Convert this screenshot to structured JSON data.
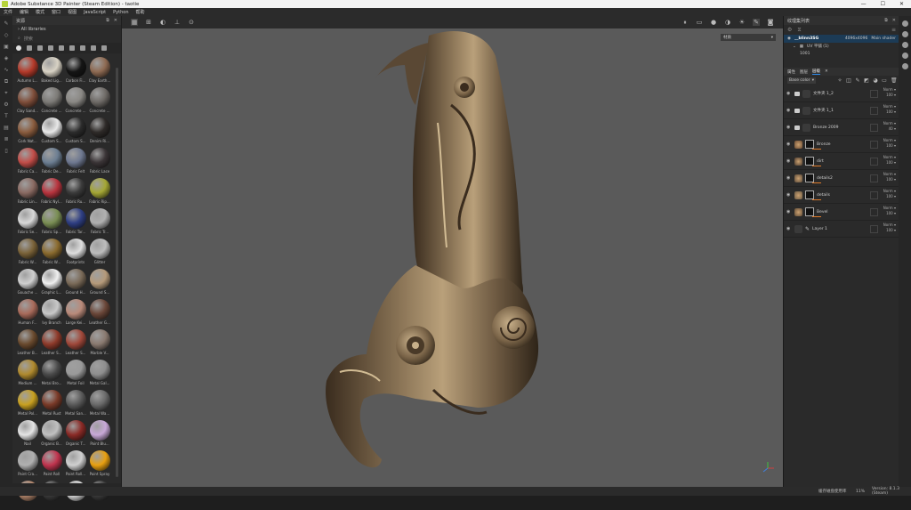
{
  "window": {
    "title": "Adobe Substance 3D Painter (Steam Edition) - taotie",
    "buttons": [
      "—",
      "☐",
      "✕"
    ]
  },
  "menu": [
    "文件",
    "编辑",
    "模式",
    "窗口",
    "视图",
    "JavaScript",
    "Python",
    "帮助"
  ],
  "shelf": {
    "title": "资源",
    "path": "All libraries",
    "search_placeholder": "搜索",
    "materials": [
      {
        "label": "Autumn L...",
        "color": "#b53a2a"
      },
      {
        "label": "Baked Lig...",
        "color": "#d8d2c4"
      },
      {
        "label": "Carbon Fi...",
        "color": "#151515"
      },
      {
        "label": "Clay Earth...",
        "color": "#8e6a52"
      },
      {
        "label": "Clay Sand...",
        "color": "#7f4e3a"
      },
      {
        "label": "Concrete ...",
        "color": "#7c7a76"
      },
      {
        "label": "Concrete ...",
        "color": "#8a8884"
      },
      {
        "label": "Concrete ...",
        "color": "#6e6a66"
      },
      {
        "label": "Cork Nat...",
        "color": "#8a5c3e"
      },
      {
        "label": "Custom S...",
        "color": "#e8e8e8"
      },
      {
        "label": "Custom S...",
        "color": "#2b2b2b"
      },
      {
        "label": "Denim Ri...",
        "color": "#2e2a28"
      },
      {
        "label": "Fabric Ca...",
        "color": "#c24d48"
      },
      {
        "label": "Fabric De...",
        "color": "#6c7e92"
      },
      {
        "label": "Fabric Felt",
        "color": "#6e7890"
      },
      {
        "label": "Fabric Lace",
        "color": "#3a3436"
      },
      {
        "label": "Fabric Lin...",
        "color": "#8a6a62"
      },
      {
        "label": "Fabric Nyl...",
        "color": "#b8343e"
      },
      {
        "label": "Fabric Ru...",
        "color": "#3a3a3a"
      },
      {
        "label": "Fabric Rip...",
        "color": "#a4a634"
      },
      {
        "label": "Fabric Se...",
        "color": "#d8d8d8"
      },
      {
        "label": "Fabric Sp...",
        "color": "#7a8e54"
      },
      {
        "label": "Fabric Tar...",
        "color": "#2e3e82"
      },
      {
        "label": "Fabric Tr...",
        "color": "#b0b0b0"
      },
      {
        "label": "Fabric W...",
        "color": "#7a6238"
      },
      {
        "label": "Fabric W...",
        "color": "#8a6a2e"
      },
      {
        "label": "Footprints",
        "color": "#dedede"
      },
      {
        "label": "Glitter",
        "color": "#bdbdbd"
      },
      {
        "label": "Gouache ...",
        "color": "#d0d0d0"
      },
      {
        "label": "Graphic L...",
        "color": "#f0f0f0"
      },
      {
        "label": "Ground H...",
        "color": "#7a6a58"
      },
      {
        "label": "Ground S...",
        "color": "#b59a7a"
      },
      {
        "label": "Human F...",
        "color": "#a86a5a"
      },
      {
        "label": "Ivy Branch",
        "color": "#c8c8c8"
      },
      {
        "label": "Large Kei...",
        "color": "#b98a7a"
      },
      {
        "label": "Leather G...",
        "color": "#6a4638"
      },
      {
        "label": "Leather B...",
        "color": "#6a4a2e"
      },
      {
        "label": "Leather S...",
        "color": "#8e3a2a"
      },
      {
        "label": "Leather S...",
        "color": "#a0483a"
      },
      {
        "label": "Marble V...",
        "color": "#8a7a70"
      },
      {
        "label": "Medium ...",
        "color": "#b08a2e"
      },
      {
        "label": "Metal Bro...",
        "color": "#4a4a4a"
      },
      {
        "label": "Metal Foil",
        "color": "#9a9a9a"
      },
      {
        "label": "Metal Gal...",
        "color": "#8e8e8e"
      },
      {
        "label": "Metal Pol...",
        "color": "#c8a020"
      },
      {
        "label": "Metal Rust",
        "color": "#7a3a28"
      },
      {
        "label": "Metal San...",
        "color": "#5a5a5a"
      },
      {
        "label": "Metal Wa...",
        "color": "#6a6a6a"
      },
      {
        "label": "Nail",
        "color": "#e4e4e4"
      },
      {
        "label": "Organic B...",
        "color": "#c0c0c0"
      },
      {
        "label": "Organic T...",
        "color": "#8a2a26"
      },
      {
        "label": "Paint Blu...",
        "color": "#c8a8d8"
      },
      {
        "label": "Paint Cra...",
        "color": "#b0b0b0"
      },
      {
        "label": "Paint Roll",
        "color": "#c0344e"
      },
      {
        "label": "Paint Roll...",
        "color": "#d0d0d0"
      },
      {
        "label": "Paint Spray",
        "color": "#e8a010"
      },
      {
        "label": "",
        "color": "#b0846a"
      },
      {
        "label": "",
        "color": "#3a3a3a"
      },
      {
        "label": "",
        "color": "#d8d8d8"
      },
      {
        "label": "",
        "color": "#3a3a3a"
      }
    ]
  },
  "viewport": {
    "material_select": "材质"
  },
  "texture_sets": {
    "title": "纹理集列表",
    "set_name": "__blinn3SG",
    "resolution": "4096x4096",
    "shader": "Main shader",
    "uv_label": "UV 平铺 (1)",
    "uv_tile": "1001"
  },
  "layers_panel": {
    "tabs": [
      "属性",
      "图层",
      "层级"
    ],
    "blend": "Base color",
    "layers": [
      {
        "name": "文件夹 1_2",
        "kind": "folder",
        "blend": "Norm",
        "opacity": "100"
      },
      {
        "name": "文件夹 1_1",
        "kind": "folder",
        "blend": "Norm",
        "opacity": "100"
      },
      {
        "name": "Bronze 2009",
        "kind": "folder",
        "blend": "Norm",
        "opacity": "40"
      },
      {
        "name": "Bronze",
        "kind": "fill",
        "blend": "Norm",
        "opacity": "100",
        "color": "#6a4a32"
      },
      {
        "name": "dirt",
        "kind": "fill",
        "blend": "Norm",
        "opacity": "100",
        "color": "#4a3a2e"
      },
      {
        "name": "details2",
        "kind": "fill",
        "blend": "Norm",
        "opacity": "100",
        "color": "#5a4a3a"
      },
      {
        "name": "details",
        "kind": "fill",
        "blend": "Norm",
        "opacity": "100",
        "color": "#6a5a44"
      },
      {
        "name": "Bevel",
        "kind": "fill",
        "blend": "Norm",
        "opacity": "100",
        "color": "#5e4a36"
      },
      {
        "name": "Layer 1",
        "kind": "paint",
        "blend": "Norm",
        "opacity": "100",
        "color": "#3a3a3a"
      }
    ]
  },
  "status": {
    "message": "缓存磁盘使用率",
    "zoom": "11%",
    "version": "Version: 8.1.3 (Steam)"
  }
}
